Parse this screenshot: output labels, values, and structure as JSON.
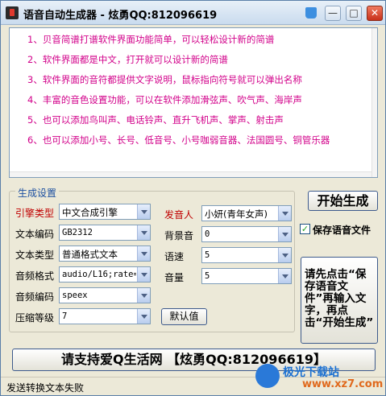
{
  "window": {
    "title": "语音自动生成器 - 炫勇QQ:812096619"
  },
  "titlebar_buttons": {
    "minimize": "—",
    "maximize": "□",
    "close": "✕"
  },
  "text_content": [
    "1、贝音简谱打谱软件界面功能简单，可以轻松设计新的简谱",
    "2、软件界面都是中文，打开就可以设计新的简谱",
    "3、软件界面的音符都提供文字说明，鼠标指向符号就可以弹出名称",
    "4、丰富的音色设置功能，可以在软件添加滑弦声、吹气声、海岸声",
    "5、也可以添加鸟叫声、电话铃声、直升飞机声、掌声、射击声",
    "6、也可以添加小号、长号、低音号、小号咖弱音器、法国圆号、铜管乐器"
  ],
  "settings": {
    "group_title": "生成设置",
    "engine_label": "引擎类型",
    "engine_value": "中文合成引擎",
    "speaker_label": "发音人",
    "speaker_value": "小妍(青年女声)",
    "text_encoding_label": "文本编码",
    "text_encoding_value": "GB2312",
    "bg_sound_label": "背景音",
    "bg_sound_value": "0",
    "text_type_label": "文本类型",
    "text_type_value": "普通格式文本",
    "speed_label": "语速",
    "speed_value": "5",
    "audio_format_label": "音频格式",
    "audio_format_value": "audio/L16;rate=",
    "volume_label": "音量",
    "volume_value": "5",
    "audio_codec_label": "音频编码",
    "audio_codec_value": "speex",
    "compression_label": "压缩等级",
    "compression_value": "7",
    "default_button": "默认值"
  },
  "actions": {
    "start_button": "开始生成",
    "save_checkbox_label": "保存语音文件",
    "save_checked": true,
    "checkmark": "✓",
    "hint": "请先点击“保存语音文件”再输入文字，再点击“开始生成”"
  },
  "banner": "请支持爱Q生活网 【炫勇QQ:812096619】",
  "status": "发送转换文本失败",
  "watermark": {
    "text": "极光下载站",
    "url": "www.xz7.com"
  },
  "colors": {
    "text_pink": "#d2008a",
    "label_red": "#c00000",
    "group_title_blue": "#1c4fa0"
  }
}
